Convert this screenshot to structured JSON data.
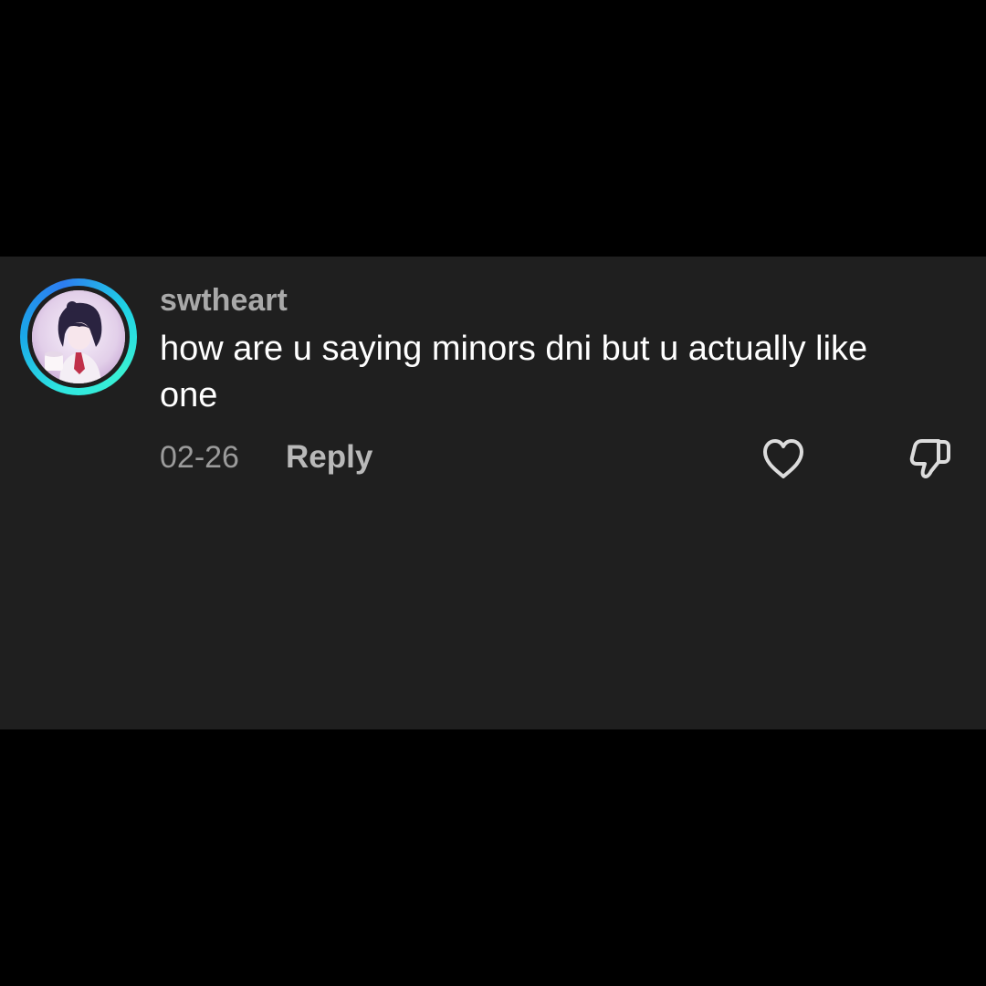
{
  "comment": {
    "username": "swtheart",
    "text": "how are u saying minors dni but u actually like one",
    "date": "02-26",
    "reply_label": "Reply",
    "avatar_icon": "anime-girl-avatar",
    "like_icon": "heart-outline-icon",
    "dislike_icon": "thumbs-down-outline-icon"
  },
  "colors": {
    "background": "#000000",
    "card": "#1f1f1f",
    "username": "#a9a9a9",
    "text": "#ffffff",
    "meta": "#9b9b9b",
    "ring_accent": "#2ee6e0"
  }
}
